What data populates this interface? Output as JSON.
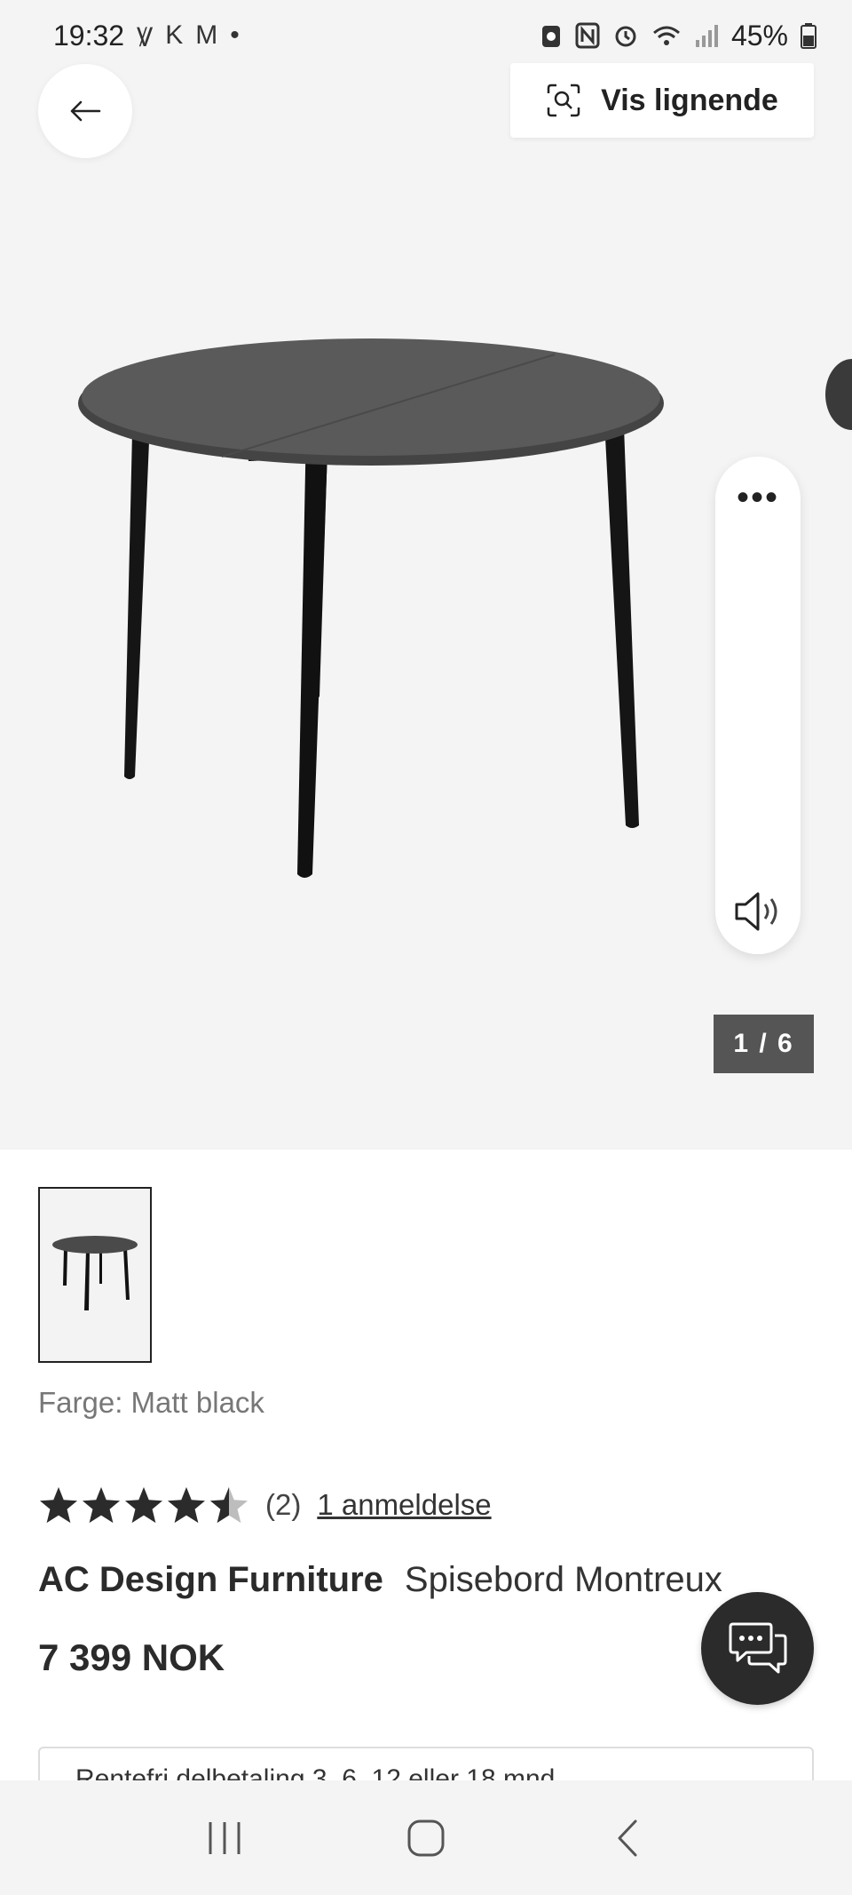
{
  "status_bar": {
    "time": "19:32",
    "left_icons": [
      "Ꝟ",
      "K",
      "M",
      "•"
    ],
    "battery": "45%"
  },
  "hero": {
    "similar_label": "Vis lignende",
    "image_counter": "1 / 6"
  },
  "product": {
    "color_label": "Farge: Matt black",
    "rating_count": "(2)",
    "review_link": "1 anmeldelse",
    "brand": "AC Design Furniture",
    "name": "Spisebord Montreux",
    "price": "7 399 NOK",
    "payment_info": "Rentefri delbetaling 3, 6, 12 eller 18 mnd"
  },
  "colors": {
    "hero_bg": "#f4f4f4",
    "dark": "#2b2b2b",
    "counter_bg": "#555555"
  }
}
